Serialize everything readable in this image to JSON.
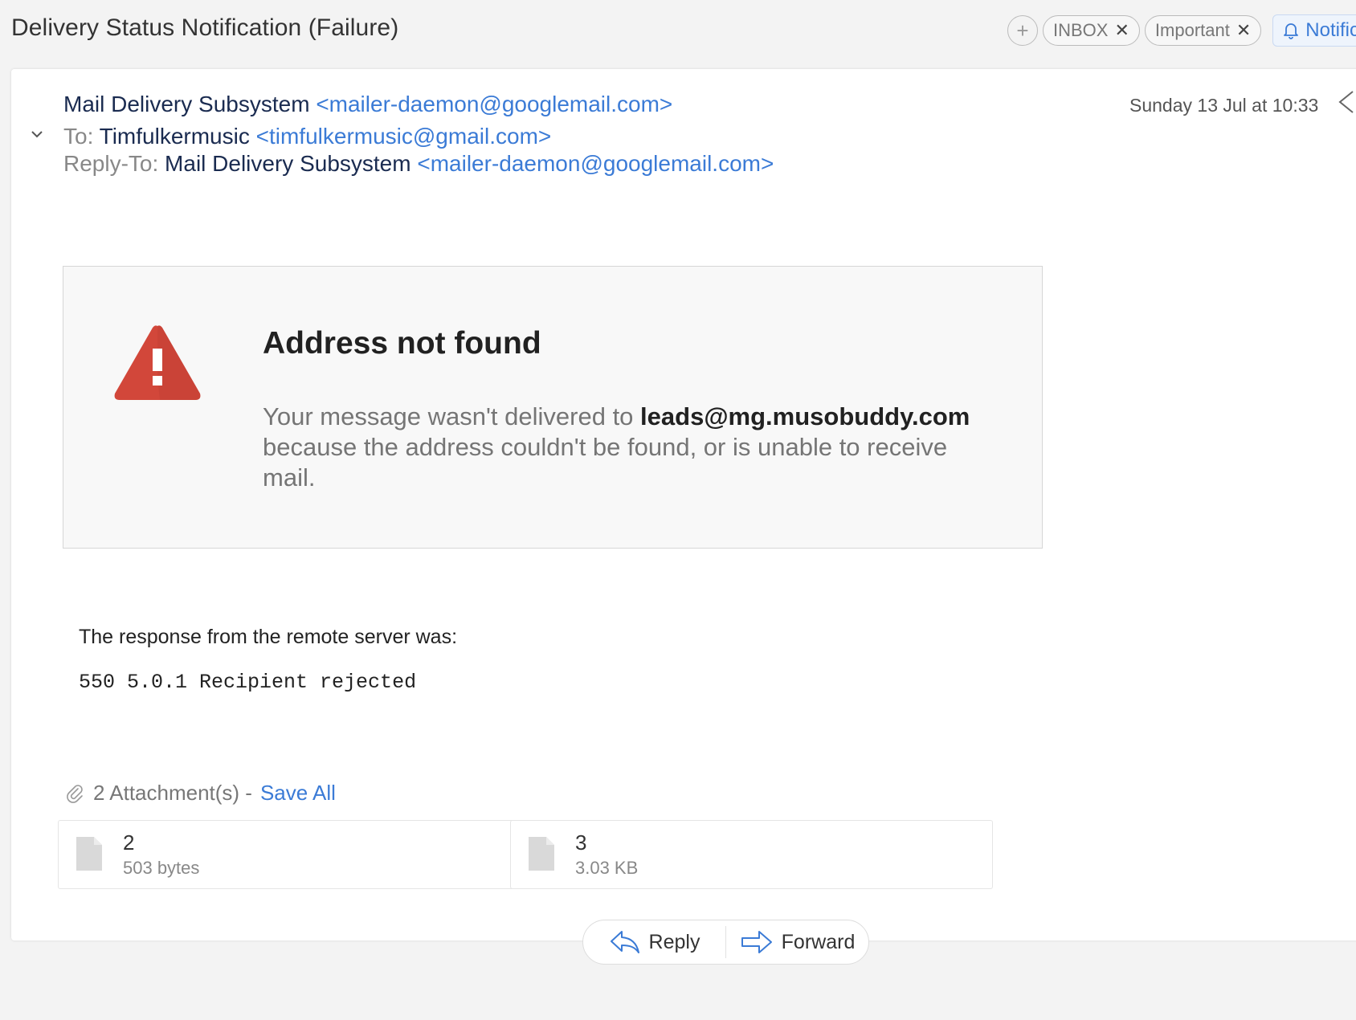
{
  "header": {
    "title": "Delivery Status Notification (Failure)",
    "add_tag_icon": "plus-icon",
    "tags": [
      {
        "label": "INBOX",
        "remove_icon": "close-icon"
      },
      {
        "label": "Important",
        "remove_icon": "close-icon"
      }
    ],
    "notification_label": "Notific",
    "notification_icon": "bell-icon"
  },
  "email": {
    "from_name": "Mail Delivery Subsystem",
    "from_address": "<mailer-daemon@googlemail.com>",
    "to_label": "To:",
    "to_name": "Timfulkermusic",
    "to_address": "<timfulkermusic@gmail.com>",
    "reply_to_label": "Reply-To:",
    "reply_to_name": "Mail Delivery Subsystem",
    "reply_to_address": "<mailer-daemon@googlemail.com>",
    "date": "Sunday 13 Jul at 10:33"
  },
  "alert": {
    "icon": "warning-triangle-icon",
    "title": "Address not found",
    "message_prefix": "Your message wasn't delivered to ",
    "recipient": "leads@mg.musobuddy.com",
    "message_suffix": " because the address couldn't be found, or is unable to receive mail."
  },
  "response": {
    "label": "The response from the remote server was:",
    "code": "550 5.0.1 Recipient rejected"
  },
  "attachments": {
    "summary": "2 Attachment(s) -",
    "save_all": "Save All",
    "items": [
      {
        "name": "2",
        "size": "503 bytes"
      },
      {
        "name": "3",
        "size": "3.03 KB"
      }
    ]
  },
  "actions": {
    "reply": "Reply",
    "forward": "Forward"
  },
  "colors": {
    "accent": "#3b7bd6",
    "warning": "#d2473a"
  }
}
